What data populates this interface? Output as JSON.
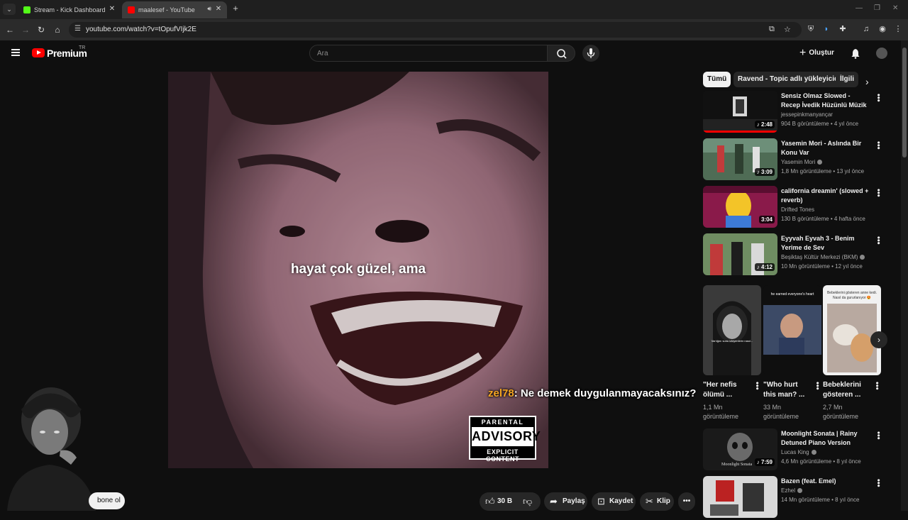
{
  "browser": {
    "tabs": [
      {
        "title": "Stream - Kick Dashboard",
        "favicon_color": "#53fc18",
        "active": false
      },
      {
        "title": "maalesef - YouTube",
        "favicon_color": "#ff0000",
        "active": true
      }
    ],
    "url": "youtube.com/watch?v=tOpufVIjk2E"
  },
  "youtube": {
    "logo_text": "Premium",
    "country_code": "TR",
    "search_placeholder": "Ara",
    "create_label": "Oluştur"
  },
  "player": {
    "subtitle": "hayat çok güzel, ama",
    "advisory_top": "PARENTAL",
    "advisory_mid": "ADVISORY",
    "advisory_bottom": "EXPLICIT CONTENT"
  },
  "stream_overlay": {
    "chat_user": "zel78",
    "chat_message": ": Ne demek duygulanmayacaksınız?"
  },
  "actions": {
    "subscribe_label": "bone ol",
    "like_count": "30 B",
    "share_label": "Paylaş",
    "save_label": "Kaydet",
    "clip_label": "Klip"
  },
  "chips": [
    "Tümü",
    "Ravend - Topic adlı yükleyiciden",
    "İlgili"
  ],
  "recommendations": [
    {
      "title": "Sensiz Olmaz Slowed - Recep İvedik Hüzünlü Müzik",
      "channel": "jessepinkmanyançar",
      "meta": "904 B görüntüleme • 4 yıl önce",
      "duration": "♪ 2:48",
      "verified": false
    },
    {
      "title": "Yasemin Mori - Aslında Bir Konu Var",
      "channel": "Yasemin Mori",
      "meta": "1,8 Mn görüntüleme • 13 yıl önce",
      "duration": "♪ 3:09",
      "verified": true
    },
    {
      "title": "california dreamin' (slowed + reverb)",
      "channel": "Drifted Tones",
      "meta": "130 B görüntüleme • 4 hafta önce",
      "duration": "3:04",
      "verified": false
    },
    {
      "title": "Eyyvah Eyvah 3 - Benim Yerime de Sev",
      "channel": "Beşiktaş Kültür Merkezi (BKM)",
      "meta": "10 Mn görüntüleme • 12 yıl önce",
      "duration": "♪ 4:12",
      "verified": true
    }
  ],
  "shorts": [
    {
      "title": "\"Her nefis ölümü ...",
      "views": "1,1 Mn görüntüleme",
      "caption": "Varlığını sunu izleyenlerin nasıl..."
    },
    {
      "title": "\"Who hurt this man? ...",
      "views": "33 Mn görüntüleme",
      "caption": "he earned everyone's heart"
    },
    {
      "title": "Bebeklerini gösteren ...",
      "views": "2,7 Mn görüntüleme",
      "caption": "Bebeklerini gösteren anne kedi. Nasıl da gururlanıyor 😍"
    }
  ],
  "recommendations_2": [
    {
      "title": "Moonlight Sonata | Rainy Detuned Piano Version",
      "channel": "Lucas King",
      "meta": "4,6 Mn görüntüleme • 8 yıl önce",
      "duration": "♪ 7:59",
      "thumb_text": "Moonlight Sonata",
      "verified": true
    },
    {
      "title": "Bazen (feat. Emel)",
      "channel": "Ezhel",
      "meta": "14 Mn görüntüleme • 8 yıl önce",
      "duration": "",
      "thumb_text": "",
      "verified": true
    }
  ],
  "colors": {
    "background": "#0f0f0f",
    "accent": "#ff0000",
    "chip_active": "#f1f1f1",
    "chat_user": "#f5a623"
  }
}
